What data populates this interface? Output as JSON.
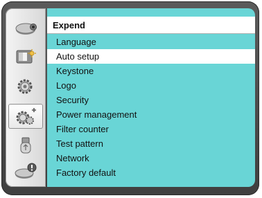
{
  "header": {
    "title": "Expend"
  },
  "sidebar": {
    "items": [
      {
        "icon": "display-icon"
      },
      {
        "icon": "picture-adjust-icon"
      },
      {
        "icon": "settings-gear-icon"
      },
      {
        "icon": "expand-gear-icon",
        "selected": true
      },
      {
        "icon": "usb-icon"
      },
      {
        "icon": "info-icon"
      }
    ]
  },
  "menu": {
    "items": [
      {
        "label": "Language"
      },
      {
        "label": "Auto setup",
        "selected": true
      },
      {
        "label": "Keystone"
      },
      {
        "label": "Logo"
      },
      {
        "label": "Security"
      },
      {
        "label": "Power management"
      },
      {
        "label": "Filter counter"
      },
      {
        "label": "Test pattern"
      },
      {
        "label": "Network"
      },
      {
        "label": "Factory default"
      }
    ]
  },
  "colors": {
    "panel": "#69d5d6",
    "selection": "#ffffff",
    "frame": "#4a4a4a"
  }
}
